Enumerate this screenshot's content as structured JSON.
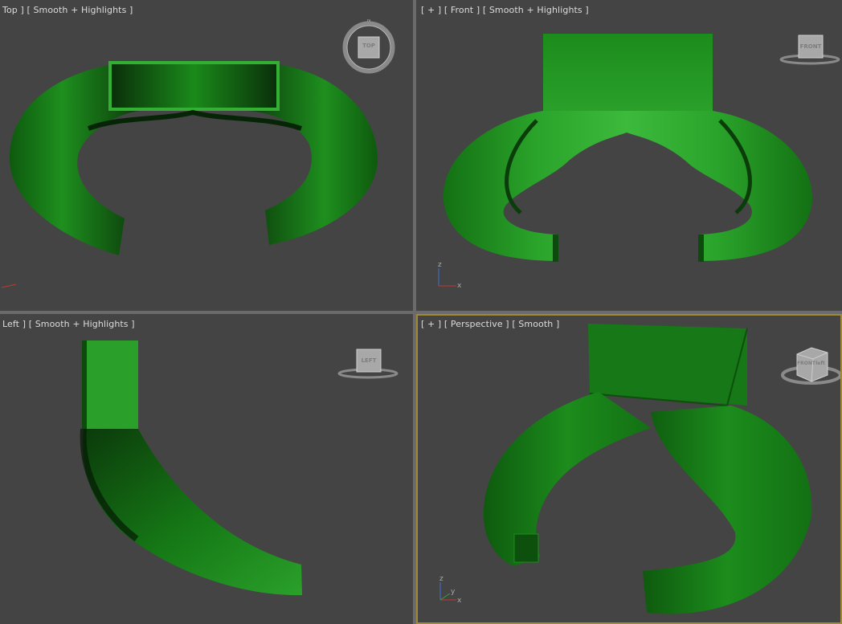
{
  "viewports": {
    "top": {
      "label_a": "Top ]",
      "label_b": "[ Smooth + Highlights ]",
      "viewcube": "TOP"
    },
    "front": {
      "label_plus": "[ + ]",
      "label_a": "[ Front ]",
      "label_b": "[ Smooth + Highlights ]",
      "viewcube": "FRONT",
      "axis_z": "z",
      "axis_x": "x"
    },
    "left": {
      "label_a": "Left ]",
      "label_b": "[ Smooth + Highlights ]",
      "viewcube": "LEFT"
    },
    "perspective": {
      "label_plus": "[ + ]",
      "label_a": "[ Perspective ]",
      "label_b": "[ Smooth ]",
      "viewcube_front": "FRONT",
      "viewcube_side": "left",
      "axis_z": "z",
      "axis_y": "y",
      "axis_x": "x"
    }
  },
  "colors": {
    "viewport_bg": "#444444",
    "mesh_green": "#1f9a1f",
    "mesh_dark": "#0a3d0a",
    "active_border": "#a08a38"
  }
}
